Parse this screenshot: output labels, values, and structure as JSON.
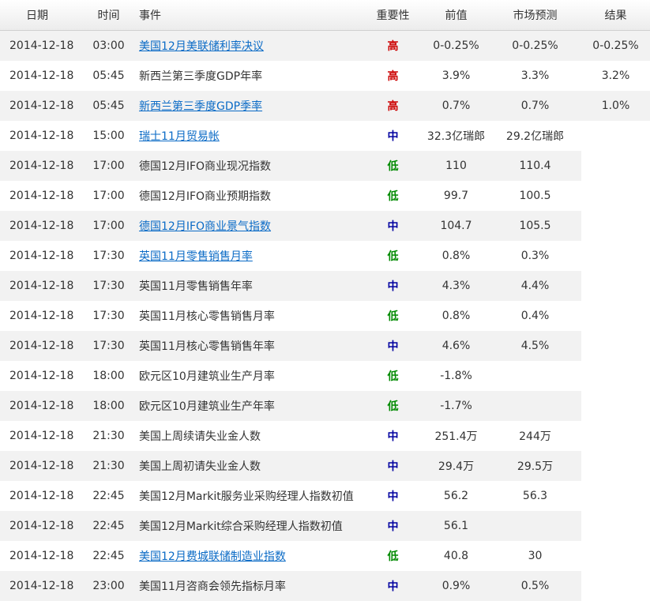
{
  "headers": {
    "date": "日期",
    "time": "时间",
    "event": "事件",
    "importance": "重要性",
    "previous": "前值",
    "forecast": "市场预测",
    "actual": "结果"
  },
  "importance_colors": {
    "高": "#cc0000",
    "中": "#0000a0",
    "低": "#008a00"
  },
  "link_color": "#0b6bc6",
  "rows": [
    {
      "date": "2014-12-18",
      "time": "03:00",
      "event": "美国12月美联储利率决议",
      "link": true,
      "importance": "高",
      "previous": "0-0.25%",
      "forecast": "0-0.25%",
      "actual": "0-0.25%"
    },
    {
      "date": "2014-12-18",
      "time": "05:45",
      "event": "新西兰第三季度GDP年率",
      "link": false,
      "importance": "高",
      "previous": "3.9%",
      "forecast": "3.3%",
      "actual": "3.2%"
    },
    {
      "date": "2014-12-18",
      "time": "05:45",
      "event": "新西兰第三季度GDP季率",
      "link": true,
      "importance": "高",
      "previous": "0.7%",
      "forecast": "0.7%",
      "actual": "1.0%"
    },
    {
      "date": "2014-12-18",
      "time": "15:00",
      "event": "瑞士11月贸易帐",
      "link": true,
      "importance": "中",
      "previous": "32.3亿瑞郎",
      "forecast": "29.2亿瑞郎",
      "actual": ""
    },
    {
      "date": "2014-12-18",
      "time": "17:00",
      "event": "德国12月IFO商业现况指数",
      "link": false,
      "importance": "低",
      "previous": "110",
      "forecast": "110.4",
      "actual": ""
    },
    {
      "date": "2014-12-18",
      "time": "17:00",
      "event": "德国12月IFO商业预期指数",
      "link": false,
      "importance": "低",
      "previous": "99.7",
      "forecast": "100.5",
      "actual": ""
    },
    {
      "date": "2014-12-18",
      "time": "17:00",
      "event": "德国12月IFO商业景气指数",
      "link": true,
      "importance": "中",
      "previous": "104.7",
      "forecast": "105.5",
      "actual": ""
    },
    {
      "date": "2014-12-18",
      "time": "17:30",
      "event": "英国11月零售销售月率",
      "link": true,
      "importance": "低",
      "previous": "0.8%",
      "forecast": "0.3%",
      "actual": ""
    },
    {
      "date": "2014-12-18",
      "time": "17:30",
      "event": "英国11月零售销售年率",
      "link": false,
      "importance": "中",
      "previous": "4.3%",
      "forecast": "4.4%",
      "actual": ""
    },
    {
      "date": "2014-12-18",
      "time": "17:30",
      "event": "英国11月核心零售销售月率",
      "link": false,
      "importance": "低",
      "previous": "0.8%",
      "forecast": "0.4%",
      "actual": ""
    },
    {
      "date": "2014-12-18",
      "time": "17:30",
      "event": "英国11月核心零售销售年率",
      "link": false,
      "importance": "中",
      "previous": "4.6%",
      "forecast": "4.5%",
      "actual": ""
    },
    {
      "date": "2014-12-18",
      "time": "18:00",
      "event": "欧元区10月建筑业生产月率",
      "link": false,
      "importance": "低",
      "previous": "-1.8%",
      "forecast": "",
      "actual": ""
    },
    {
      "date": "2014-12-18",
      "time": "18:00",
      "event": "欧元区10月建筑业生产年率",
      "link": false,
      "importance": "低",
      "previous": "-1.7%",
      "forecast": "",
      "actual": ""
    },
    {
      "date": "2014-12-18",
      "time": "21:30",
      "event": "美国上周续请失业金人数",
      "link": false,
      "importance": "中",
      "previous": "251.4万",
      "forecast": "244万",
      "actual": ""
    },
    {
      "date": "2014-12-18",
      "time": "21:30",
      "event": "美国上周初请失业金人数",
      "link": false,
      "importance": "中",
      "previous": "29.4万",
      "forecast": "29.5万",
      "actual": ""
    },
    {
      "date": "2014-12-18",
      "time": "22:45",
      "event": "美国12月Markit服务业采购经理人指数初值",
      "link": false,
      "importance": "中",
      "previous": "56.2",
      "forecast": "56.3",
      "actual": ""
    },
    {
      "date": "2014-12-18",
      "time": "22:45",
      "event": "美国12月Markit综合采购经理人指数初值",
      "link": false,
      "importance": "中",
      "previous": "56.1",
      "forecast": "",
      "actual": ""
    },
    {
      "date": "2014-12-18",
      "time": "22:45",
      "event": "美国12月费城联储制造业指数",
      "link": true,
      "importance": "低",
      "previous": "40.8",
      "forecast": "30",
      "actual": ""
    },
    {
      "date": "2014-12-18",
      "time": "23:00",
      "event": "美国11月咨商会领先指标月率",
      "link": false,
      "importance": "中",
      "previous": "0.9%",
      "forecast": "0.5%",
      "actual": ""
    }
  ]
}
